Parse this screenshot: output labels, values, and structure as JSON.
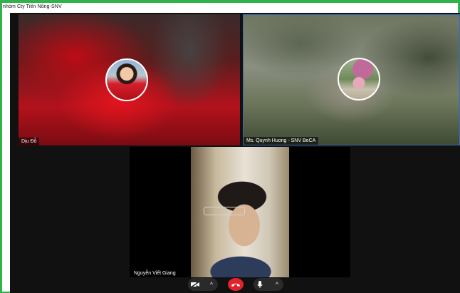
{
  "window": {
    "title": "nhóm Cty Tiến Nông-SNV",
    "accent": "#2fb34a"
  },
  "participants": [
    {
      "name": "Dịu Đỗ"
    },
    {
      "name": "Ms. Quynh Huong - SNV BeCA"
    },
    {
      "name": "Nguyễn Viết Giang"
    }
  ],
  "controls": {
    "camera": {
      "icon": "camera-off-icon",
      "chevron": "^"
    },
    "end_call": {
      "icon": "phone-hangup-icon",
      "color": "#e0242c"
    },
    "microphone": {
      "icon": "microphone-icon",
      "chevron": "^"
    }
  }
}
